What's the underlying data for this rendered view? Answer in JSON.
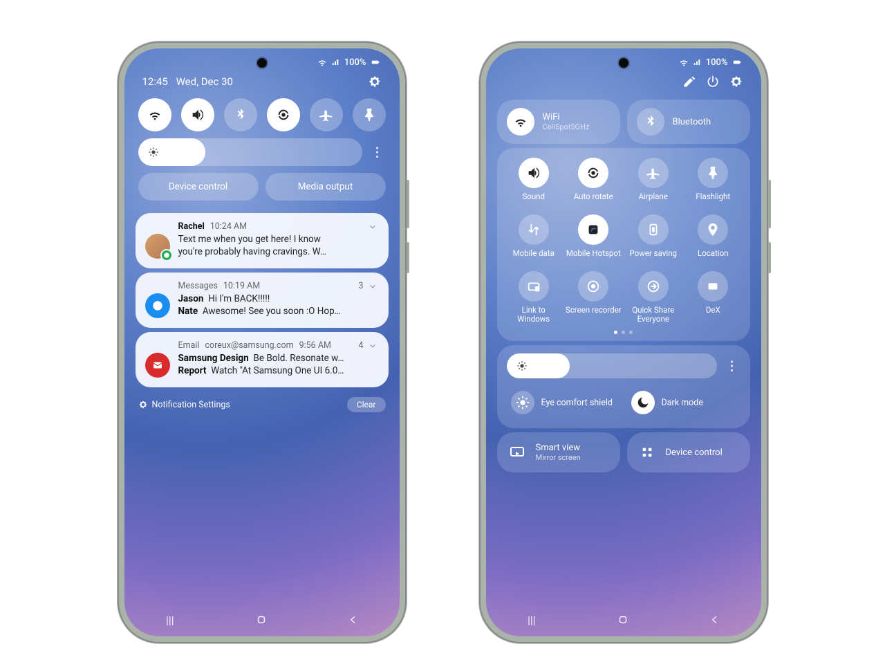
{
  "status": {
    "battery_text": "100%",
    "signal": "full",
    "wifi": "on"
  },
  "phone1": {
    "time": "12:45",
    "date": "Wed, Dec 30",
    "toggles": [
      {
        "name": "wifi",
        "on": true
      },
      {
        "name": "sound",
        "on": true
      },
      {
        "name": "bluetooth",
        "on": false
      },
      {
        "name": "autorotate",
        "on": true
      },
      {
        "name": "airplane",
        "on": false
      },
      {
        "name": "flashlight",
        "on": false
      }
    ],
    "brightness_pct": 30,
    "pills": {
      "device": "Device control",
      "media": "Media output"
    },
    "notifications": [
      {
        "app": "Rachel",
        "time": "10:24 AM",
        "line1": "Text me when you get here! I know",
        "line2": "you're probably having cravings. W…"
      },
      {
        "app": "Messages",
        "time": "10:19 AM",
        "count": "3",
        "row1_name": "Jason",
        "row1_text": "Hi I'm BACK!!!!!",
        "row2_name": "Nate",
        "row2_text": "Awesome! See you soon :O Hop…"
      },
      {
        "app": "Email",
        "sender": "coreux@samsung.com",
        "time": "9:56 AM",
        "count": "4",
        "row1_name": "Samsung Design",
        "row1_text": "Be Bold. Resonate w…",
        "row2_name": "Report",
        "row2_text": "Watch \"At Samsung One UI 6.0…"
      }
    ],
    "footer": {
      "settings": "Notification Settings",
      "clear": "Clear"
    }
  },
  "phone2": {
    "wifi": {
      "label": "WiFi",
      "sub": "CellSpot5GHz",
      "on": true
    },
    "bluetooth": {
      "label": "Bluetooth",
      "on": false
    },
    "grid": [
      {
        "label": "Sound",
        "icon": "sound",
        "on": true
      },
      {
        "label": "Auto rotate",
        "icon": "autorotate",
        "on": true
      },
      {
        "label": "Airplane",
        "icon": "airplane",
        "on": false
      },
      {
        "label": "Flashlight",
        "icon": "flashlight",
        "on": false
      },
      {
        "label": "Mobile data",
        "icon": "mobiledata",
        "on": false
      },
      {
        "label": "Mobile Hotspot",
        "icon": "hotspot",
        "on": true
      },
      {
        "label": "Power saving",
        "icon": "powersave",
        "on": false
      },
      {
        "label": "Location",
        "icon": "location",
        "on": false
      },
      {
        "label": "Link to Windows",
        "icon": "link",
        "on": false
      },
      {
        "label": "Screen recorder",
        "icon": "screenrec",
        "on": false
      },
      {
        "label": "Quick Share Everyone",
        "icon": "quickshare",
        "on": false
      },
      {
        "label": "DeX",
        "icon": "dex",
        "on": false
      }
    ],
    "brightness_pct": 30,
    "eye": "Eye comfort shield",
    "dark": "Dark mode",
    "smartview": {
      "label": "Smart view",
      "sub": "Mirror screen"
    },
    "device_control": "Device control"
  }
}
